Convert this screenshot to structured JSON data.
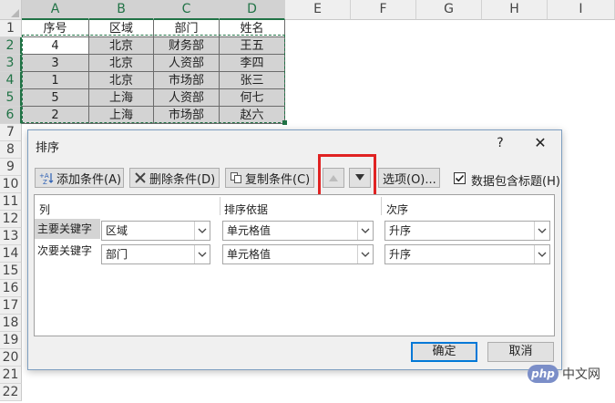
{
  "sheet": {
    "columns": [
      "A",
      "B",
      "C",
      "D",
      "E",
      "F",
      "G",
      "H",
      "I"
    ],
    "rows": [
      "1",
      "2",
      "3",
      "4",
      "5",
      "6",
      "7",
      "8",
      "9",
      "10",
      "11",
      "12",
      "13",
      "14",
      "15",
      "16",
      "17",
      "18",
      "19",
      "20",
      "21",
      "22"
    ],
    "header_row": [
      "序号",
      "区域",
      "部门",
      "姓名"
    ],
    "data_rows": [
      [
        "4",
        "北京",
        "财务部",
        "王五"
      ],
      [
        "3",
        "北京",
        "人资部",
        "李四"
      ],
      [
        "1",
        "北京",
        "市场部",
        "张三"
      ],
      [
        "5",
        "上海",
        "人资部",
        "何七"
      ],
      [
        "2",
        "上海",
        "市场部",
        "赵六"
      ]
    ]
  },
  "dialog": {
    "title": "排序",
    "help": "?",
    "close": "✕",
    "toolbar": {
      "add_label": "添加条件(A)",
      "delete_label": "删除条件(D)",
      "copy_label": "复制条件(C)",
      "options_label": "选项(O)...",
      "has_header_label": "数据包含标题(H)"
    },
    "grid": {
      "headers": {
        "column": "列",
        "sort_on": "排序依据",
        "order": "次序"
      },
      "rows": [
        {
          "label": "主要关键字",
          "column": "区域",
          "sort_on": "单元格值",
          "order": "升序"
        },
        {
          "label": "次要关键字",
          "column": "部门",
          "sort_on": "单元格值",
          "order": "升序"
        }
      ]
    },
    "ok_label": "确定",
    "cancel_label": "取消"
  },
  "watermark": {
    "logo": "php",
    "text": "中文网"
  },
  "colors": {
    "excel_green": "#217346",
    "highlight_red": "#e02222",
    "accent_blue": "#0078d7"
  }
}
